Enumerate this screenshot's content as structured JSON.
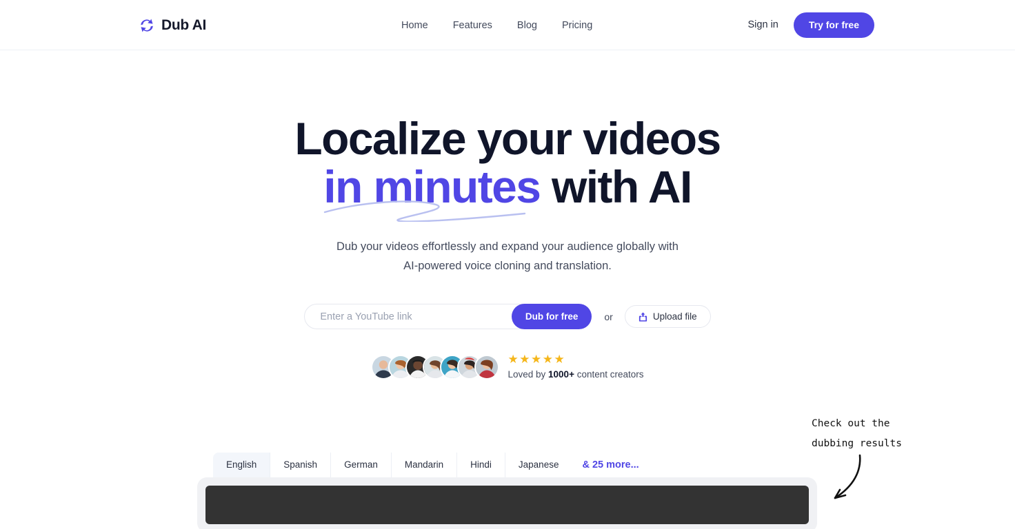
{
  "header": {
    "brand": {
      "name": "Dub AI",
      "icon": "sync-arrows-icon"
    },
    "nav": [
      {
        "label": "Home"
      },
      {
        "label": "Features"
      },
      {
        "label": "Blog"
      },
      {
        "label": "Pricing"
      }
    ],
    "sign_in_label": "Sign in",
    "try_free_label": "Try for free"
  },
  "hero": {
    "headline_line1": "Localize your videos",
    "headline_accent": "in minutes",
    "headline_tail": " with AI",
    "subhead_line1": "Dub your videos effortlessly and expand your audience globally with",
    "subhead_line2": "AI-powered voice cloning and translation."
  },
  "cta": {
    "url_placeholder": "Enter a YouTube link",
    "url_value": "",
    "dub_label": "Dub for free",
    "or_label": "or",
    "upload_label": "Upload file",
    "upload_icon": "upload-icon"
  },
  "social_proof": {
    "stars": "★★★★★",
    "star_count": 5,
    "loved_prefix": "Loved by ",
    "loved_count": "1000+",
    "loved_suffix": " content creators",
    "avatar_count": 7
  },
  "annotation": {
    "text": "Check out the\ndubbing results",
    "arrow_icon": "curved-arrow-down-left-icon"
  },
  "showcase": {
    "tabs": [
      {
        "label": "English",
        "active": true
      },
      {
        "label": "Spanish",
        "active": false
      },
      {
        "label": "German",
        "active": false
      },
      {
        "label": "Mandarin",
        "active": false
      },
      {
        "label": "Hindi",
        "active": false
      },
      {
        "label": "Japanese",
        "active": false
      }
    ],
    "more_label": "& 25 more..."
  },
  "colors": {
    "accent": "#5046e5",
    "heading": "#10152a",
    "body": "#434a5c",
    "star": "#f5b61a",
    "player_bg": "#333333",
    "shell_bg": "#f0f1f4",
    "tab_active_bg": "#f3f6fb"
  }
}
